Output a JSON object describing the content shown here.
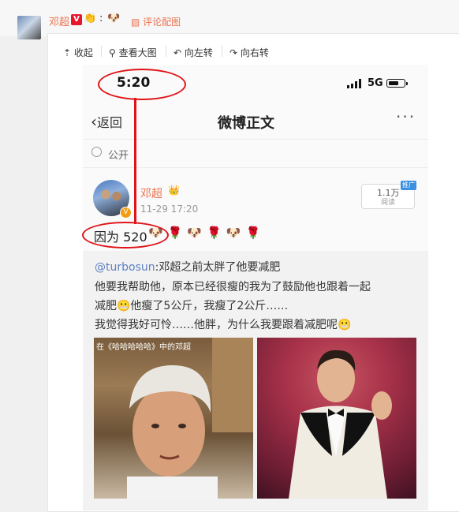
{
  "header": {
    "name": "邓超",
    "v_badge": "V",
    "colon": ":",
    "comment_image_label": "评论配图"
  },
  "toolbar": {
    "collapse": "收起",
    "view_large": "查看大图",
    "rotate_left": "向左转",
    "rotate_right": "向右转"
  },
  "phone": {
    "status_time": "5:20",
    "network": "5G",
    "nav_back": "返回",
    "nav_title": "微博正文",
    "visibility": "公开"
  },
  "post": {
    "author": "邓超",
    "time": "11-29 17:20",
    "reads_count": "1.1万",
    "reads_label": "阅读",
    "promo_tag": "推广",
    "text": "因为 520"
  },
  "quote": {
    "handle": "@turbosun",
    "line1_rest": ":邓超之前太胖了他要减肥",
    "line2": "他要我帮助他，原本已经很瘦的我为了鼓励他也跟着一起",
    "line3": "减肥😬他瘦了5公斤，我瘦了2公斤……",
    "line4": "我觉得我好可怜……他胖，为什么我要跟着减肥呢😬",
    "photo_caption": "在《哈哈哈哈哈》中的邓超"
  },
  "colors": {
    "accent_orange": "#eb7350",
    "annotation_red": "#e01418",
    "link_blue": "#5d81bf"
  },
  "icons": [
    "collapse-icon",
    "search-icon",
    "rotate-left-icon",
    "rotate-right-icon",
    "signal-icon",
    "battery-icon",
    "back-chevron-icon",
    "more-icon",
    "globe-icon",
    "rose-icon",
    "doge-icon"
  ]
}
